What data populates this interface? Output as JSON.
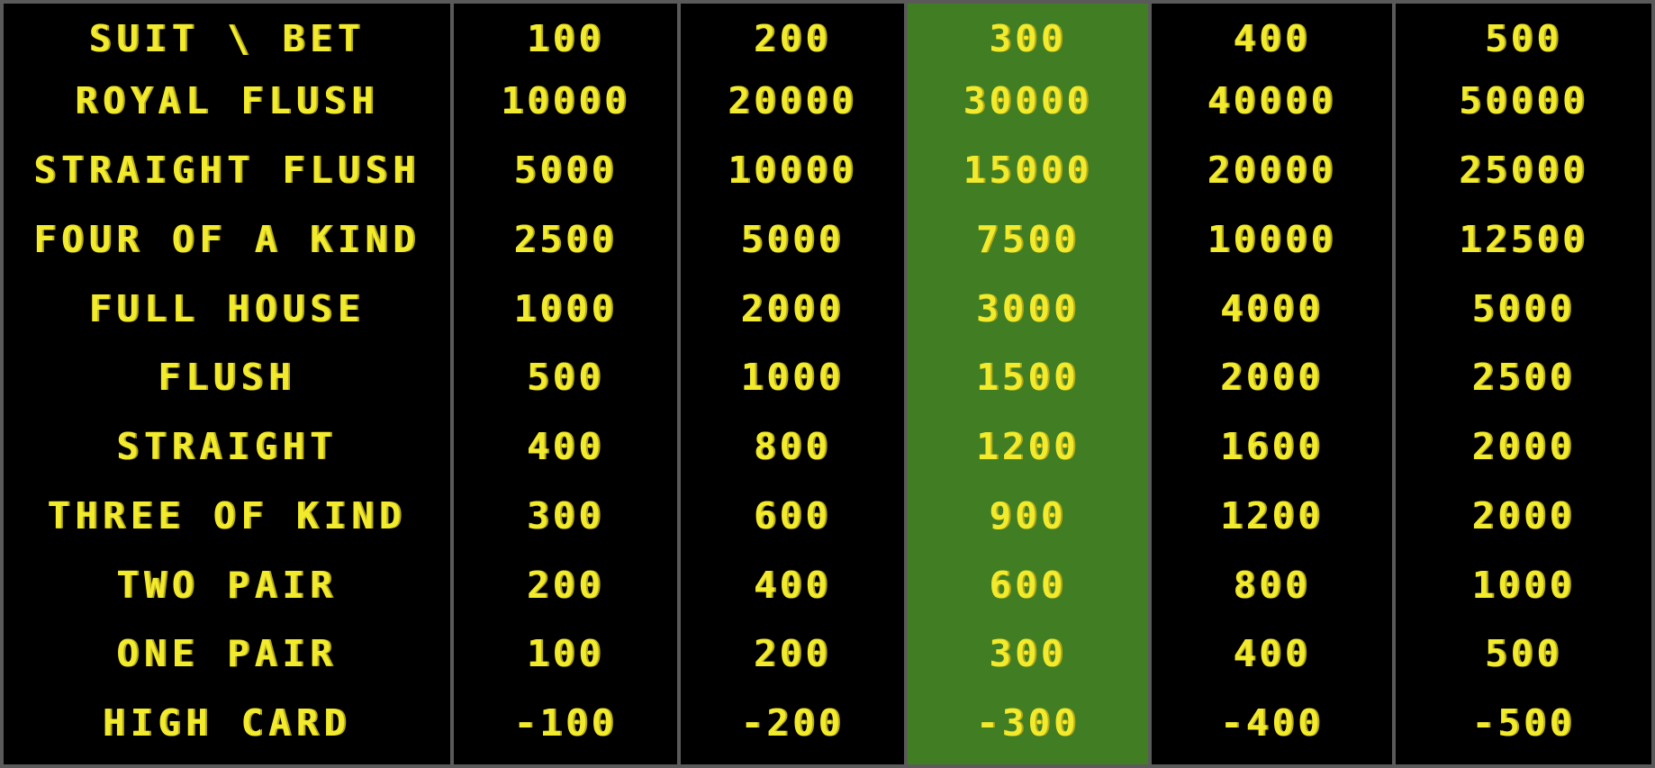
{
  "header": {
    "corner_label": "SUIT \\ BET",
    "bets": [
      "100",
      "200",
      "300",
      "400",
      "500"
    ],
    "highlighted_bet": "300"
  },
  "hands": [
    {
      "name": "ROYAL FLUSH",
      "payouts": [
        "10000",
        "20000",
        "30000",
        "40000",
        "50000"
      ]
    },
    {
      "name": "STRAIGHT FLUSH",
      "payouts": [
        "5000",
        "10000",
        "15000",
        "20000",
        "25000"
      ]
    },
    {
      "name": "FOUR OF A KIND",
      "payouts": [
        "2500",
        "5000",
        "7500",
        "10000",
        "12500"
      ]
    },
    {
      "name": "FULL HOUSE",
      "payouts": [
        "1000",
        "2000",
        "3000",
        "4000",
        "5000"
      ]
    },
    {
      "name": "FLUSH",
      "payouts": [
        "500",
        "1000",
        "1500",
        "2000",
        "2500"
      ]
    },
    {
      "name": "STRAIGHT",
      "payouts": [
        "400",
        "800",
        "1200",
        "1600",
        "2000"
      ]
    },
    {
      "name": "THREE OF KIND",
      "payouts": [
        "300",
        "600",
        "900",
        "1200",
        "2000"
      ]
    },
    {
      "name": "TWO PAIR",
      "payouts": [
        "200",
        "400",
        "600",
        "800",
        "1000"
      ]
    },
    {
      "name": "ONE PAIR",
      "payouts": [
        "100",
        "200",
        "300",
        "400",
        "500"
      ]
    },
    {
      "name": "HIGH CARD",
      "payouts": [
        "-100",
        "-200",
        "-300",
        "-400",
        "-500"
      ]
    }
  ],
  "colors": {
    "text": "#f2ea2c",
    "background": "#000000",
    "highlight": "#417d22",
    "grid": "#5a5a5a"
  }
}
